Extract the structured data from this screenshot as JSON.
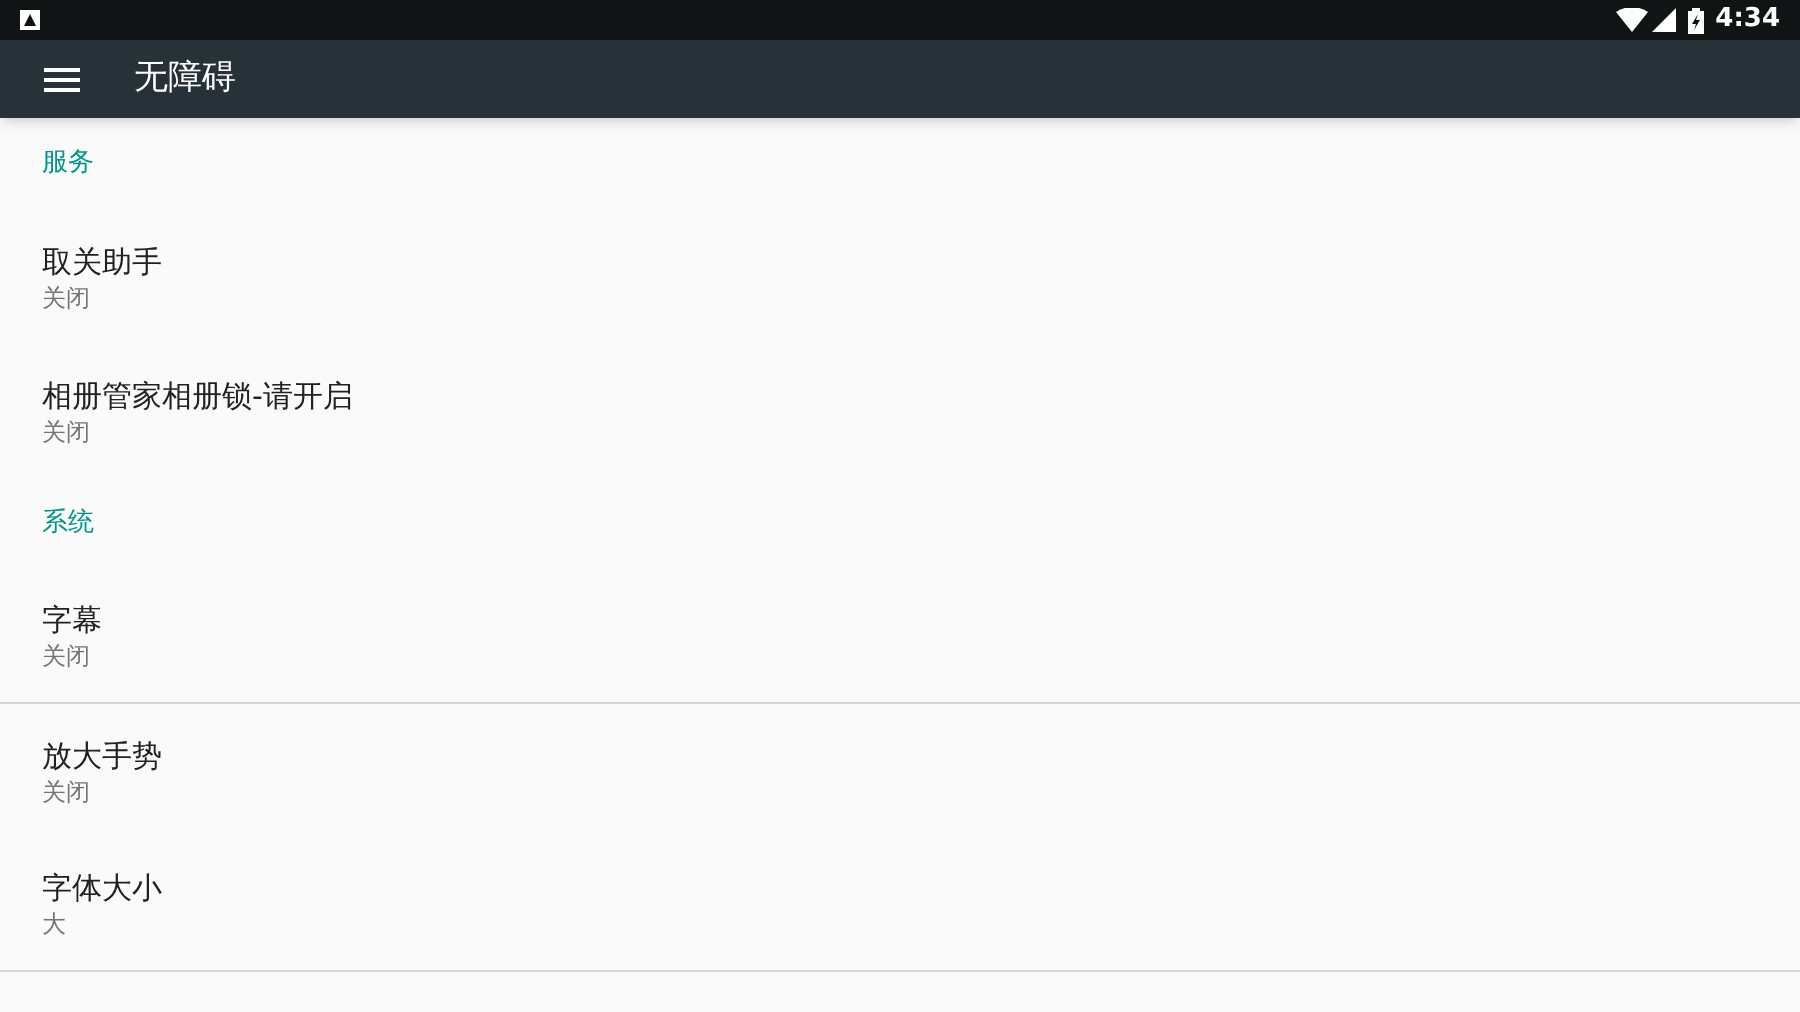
{
  "status_bar": {
    "time": "4:34"
  },
  "toolbar": {
    "title": "无障碍"
  },
  "sections": [
    {
      "header": "服务",
      "items": [
        {
          "title": "取关助手",
          "summary": "关闭",
          "divider_below": false
        },
        {
          "title": "相册管家相册锁-请开启",
          "summary": "关闭",
          "divider_below": false
        }
      ]
    },
    {
      "header": "系统",
      "items": [
        {
          "title": "字幕",
          "summary": "关闭",
          "divider_below": true
        },
        {
          "title": "放大手势",
          "summary": "关闭",
          "divider_below": false
        },
        {
          "title": "字体大小",
          "summary": "大",
          "divider_below": true
        }
      ]
    }
  ]
}
